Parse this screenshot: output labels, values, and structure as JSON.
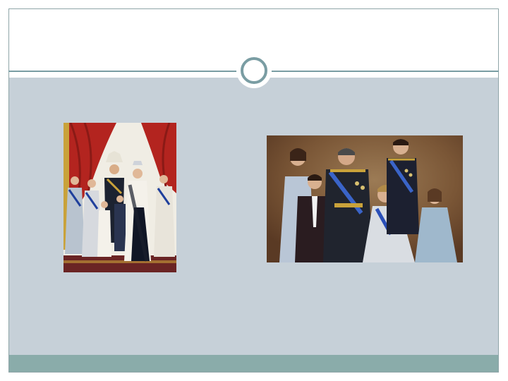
{
  "slide": {
    "title": "",
    "colors": {
      "content_background": "#c6d0d8",
      "footer_bar": "#8aacaa",
      "accent": "#7a9da3"
    }
  },
  "images": [
    {
      "name": "left-photo",
      "alt": "",
      "icon": "photo-icon"
    },
    {
      "name": "right-photo",
      "alt": "",
      "icon": "photo-icon"
    }
  ]
}
